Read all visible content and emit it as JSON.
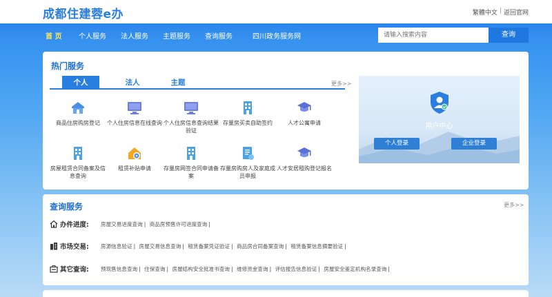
{
  "header": {
    "site_title": "成都住建蓉e办",
    "lang_link": "繁體中文",
    "home_link": "返回官网"
  },
  "nav": {
    "items": [
      "首 页",
      "个人服务",
      "法人服务",
      "主题服务",
      "查询服务",
      "四川政务服务网"
    ],
    "search_placeholder": "请输入搜索内容",
    "search_button": "查询"
  },
  "hot": {
    "title": "热门服务",
    "tabs": [
      "个人",
      "法人",
      "主题"
    ],
    "more": "更多>>",
    "services": [
      {
        "label": "商品住房购房登记",
        "icon": "house-icon"
      },
      {
        "label": "个人住房信息在线查询",
        "icon": "monitor-icon"
      },
      {
        "label": "个人住房信息查询结果验证",
        "icon": "monitor-icon"
      },
      {
        "label": "存量房买卖自助签约",
        "icon": "building-icon"
      },
      {
        "label": "人才公寓申请",
        "icon": "graduation-cap-icon"
      },
      {
        "label": "房屋租赁合同备案及信息查询",
        "icon": "building-icon"
      },
      {
        "label": "租赁补贴申请",
        "icon": "house-gear-icon"
      },
      {
        "label": "存量房网签合同申请备案",
        "icon": "building-icon"
      },
      {
        "label": "存量房购房人及家庭成员申报",
        "icon": "document-icon"
      },
      {
        "label": "人才安居租购登记报名",
        "icon": "graduation-cap-icon"
      }
    ],
    "colors": {
      "primary": "#2a7ee0",
      "icon_blue": "#4a8fe6",
      "icon_gold": "#f2a81d"
    }
  },
  "user_center": {
    "label": "用户中心",
    "personal_login": "个人登录",
    "company_login": "企业登录"
  },
  "query": {
    "title": "查询服务",
    "more": "更多>>",
    "rows": [
      {
        "head": "办件进度:",
        "icon": "home-outline-icon",
        "links": [
          "房屋交易进度查询",
          "商品房预售许可进度查询"
        ]
      },
      {
        "head": "市场交易:",
        "icon": "city-icon",
        "links": [
          "房源信息验证",
          "房屋交易信息查询",
          "租赁备案凭证验证",
          "商品房合同备案查询",
          "租赁备案信息摘要验证"
        ]
      },
      {
        "head": "其它查询:",
        "icon": "case-icon",
        "links": [
          "预现售信息查询",
          "住保查询",
          "房屋结构安全批准书查询",
          "维修资金查询",
          "评估报告信息验证",
          "房屋安全鉴定机构名录查询"
        ]
      }
    ]
  }
}
